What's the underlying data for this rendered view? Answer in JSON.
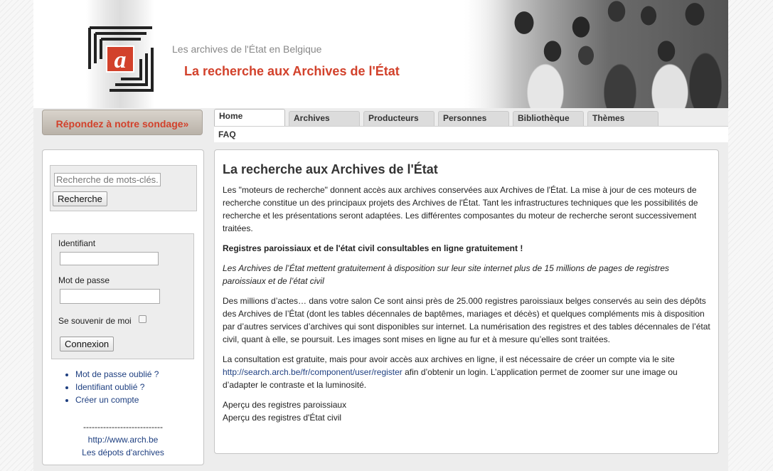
{
  "header": {
    "subtitle": "Les archives de l'État en Belgique",
    "title": "La recherche aux Archives de l'État",
    "logo_letter": "a"
  },
  "survey": {
    "label": "Répondez à notre sondage»"
  },
  "tabs": [
    {
      "label": "Home",
      "active": true
    },
    {
      "label": "Archives"
    },
    {
      "label": "Producteurs"
    },
    {
      "label": "Personnes"
    },
    {
      "label": "Bibliothèque"
    },
    {
      "label": "Thèmes"
    },
    {
      "label": "FAQ"
    }
  ],
  "search": {
    "placeholder": "Recherche de mots-clés...",
    "button": "Recherche"
  },
  "login": {
    "username_label": "Identifiant",
    "password_label": "Mot de passe",
    "remember_label": "Se souvenir de moi",
    "button": "Connexion"
  },
  "account_links": [
    "Mot de passe oublié ?",
    "Identifiant oublié ?",
    "Créer un compte"
  ],
  "separator": "----------------------------",
  "external_links": [
    "http://www.arch.be",
    "Les dépots d'archives"
  ],
  "content": {
    "heading": "La recherche aux Archives de l'État",
    "p1": "Les \"moteurs de recherche\" donnent accès aux archives conservées aux Archives de l'État. La mise à jour de ces moteurs de recherche constitue un des principaux projets des Archives de l'État. Tant les infrastructures techniques que les possibilités de recherche et les présentations seront adaptées. Les différentes composantes du moteur de recherche seront successivement traitées.",
    "p2": "Registres paroissiaux et de l'état civil consultables en ligne gratuitement !",
    "p3": "Les Archives de l’État mettent gratuitement à disposition sur leur site internet plus de 15 millions de pages de registres paroissiaux et de l’état civil",
    "p4": "Des millions d’actes… dans votre salon Ce sont ainsi près de 25.000 registres paroissiaux belges conservés au sein des dépôts des Archives de l’État (dont les tables décennales de baptêmes, mariages et décès) et quelques compléments mis à disposition par d’autres services d’archives qui sont disponibles sur internet. La numérisation des registres et des tables décennales de l’état civil, quant à elle, se poursuit. Les images sont mises en ligne au fur et à mesure qu’elles sont traitées.",
    "p5_before": "La consultation est gratuite, mais pour avoir accès aux archives en ligne, il est nécessaire de créer un compte via le site ",
    "p5_link": "http://search.arch.be/fr/component/user/register",
    "p5_after": " afin d’obtenir un login. L’application permet de zoomer sur une image ou d’adapter le contraste et la luminosité.",
    "link1": "Aperçu des registres paroissiaux",
    "link2": "Aperçu des registres d'État civil"
  },
  "colors": {
    "accent": "#d2412b",
    "link": "#1e3f80"
  }
}
